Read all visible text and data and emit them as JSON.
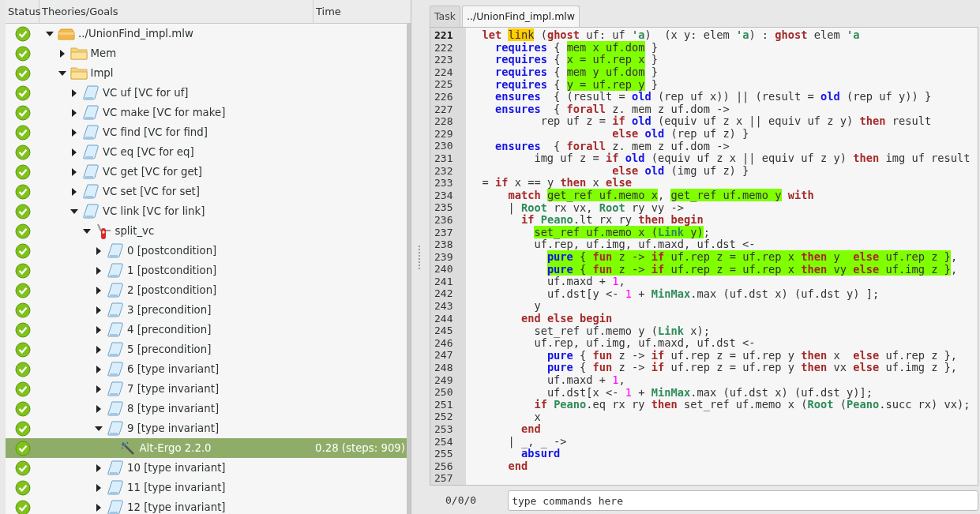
{
  "tree": {
    "columns": [
      "Status",
      "Theories/Goals",
      "Time"
    ],
    "nodes": [
      {
        "label": "../UnionFind_impl.mlw",
        "kind": "file",
        "proved": true,
        "expanded": true,
        "selected": false,
        "children": [
          {
            "label": "Mem",
            "kind": "theory",
            "proved": true,
            "expanded": false,
            "selected": false
          },
          {
            "label": "Impl",
            "kind": "theory",
            "proved": true,
            "expanded": true,
            "selected": false,
            "children": [
              {
                "label": "VC uf [VC for uf]",
                "kind": "goal",
                "proved": true,
                "expanded": false,
                "selected": false
              },
              {
                "label": "VC make [VC for make]",
                "kind": "goal",
                "proved": true,
                "expanded": false,
                "selected": false
              },
              {
                "label": "VC find [VC for find]",
                "kind": "goal",
                "proved": true,
                "expanded": false,
                "selected": false
              },
              {
                "label": "VC eq [VC for eq]",
                "kind": "goal",
                "proved": true,
                "expanded": false,
                "selected": false
              },
              {
                "label": "VC get [VC for get]",
                "kind": "goal",
                "proved": true,
                "expanded": false,
                "selected": false
              },
              {
                "label": "VC set [VC for set]",
                "kind": "goal",
                "proved": true,
                "expanded": false,
                "selected": false
              },
              {
                "label": "VC link [VC for link]",
                "kind": "goal",
                "proved": true,
                "expanded": true,
                "selected": false,
                "children": [
                  {
                    "label": "split_vc",
                    "kind": "transformation",
                    "proved": true,
                    "expanded": true,
                    "selected": false,
                    "children": [
                      {
                        "label": "0 [postcondition]",
                        "kind": "goal",
                        "proved": true,
                        "expanded": false,
                        "selected": false
                      },
                      {
                        "label": "1 [postcondition]",
                        "kind": "goal",
                        "proved": true,
                        "expanded": false,
                        "selected": false
                      },
                      {
                        "label": "2 [postcondition]",
                        "kind": "goal",
                        "proved": true,
                        "expanded": false,
                        "selected": false
                      },
                      {
                        "label": "3 [precondition]",
                        "kind": "goal",
                        "proved": true,
                        "expanded": false,
                        "selected": false
                      },
                      {
                        "label": "4 [precondition]",
                        "kind": "goal",
                        "proved": true,
                        "expanded": false,
                        "selected": false
                      },
                      {
                        "label": "5 [precondition]",
                        "kind": "goal",
                        "proved": true,
                        "expanded": false,
                        "selected": false
                      },
                      {
                        "label": "6 [type invariant]",
                        "kind": "goal",
                        "proved": true,
                        "expanded": false,
                        "selected": false
                      },
                      {
                        "label": "7 [type invariant]",
                        "kind": "goal",
                        "proved": true,
                        "expanded": false,
                        "selected": false
                      },
                      {
                        "label": "8 [type invariant]",
                        "kind": "goal",
                        "proved": true,
                        "expanded": false,
                        "selected": false
                      },
                      {
                        "label": "9 [type invariant]",
                        "kind": "goal",
                        "proved": true,
                        "expanded": true,
                        "selected": false,
                        "children": [
                          {
                            "label": "Alt-Ergo 2.2.0",
                            "kind": "prover",
                            "proved": true,
                            "selected": true,
                            "time": "0.28 (steps: 909)"
                          }
                        ]
                      },
                      {
                        "label": "10 [type invariant]",
                        "kind": "goal",
                        "proved": true,
                        "expanded": false,
                        "selected": false
                      },
                      {
                        "label": "11 [type invariant]",
                        "kind": "goal",
                        "proved": true,
                        "expanded": false,
                        "selected": false
                      },
                      {
                        "label": "12 [type invariant]",
                        "kind": "goal",
                        "proved": true,
                        "expanded": false,
                        "selected": false
                      }
                    ]
                  }
                ]
              }
            ]
          }
        ]
      }
    ]
  },
  "tabs": [
    {
      "label": "Task",
      "selected": false
    },
    {
      "label": "../UnionFind_impl.mlw",
      "selected": true
    }
  ],
  "editor": {
    "lines": [
      {
        "number": "221",
        "current": true,
        "segments": [
          {
            "text": "  let ",
            "kind": "keyword"
          },
          {
            "text": "link",
            "kind": "plain",
            "color": "#ffcc00"
          },
          {
            "text": " (",
            "kind": "plain"
          },
          {
            "text": "ghost",
            "kind": "keyword"
          },
          {
            "text": " uf: uf ",
            "kind": "plain"
          },
          {
            "text": "'a",
            "kind": "module"
          },
          {
            "text": ")  (x y: elem ",
            "kind": "plain"
          },
          {
            "text": "'a",
            "kind": "module"
          },
          {
            "text": ") : ",
            "kind": "plain"
          },
          {
            "text": "ghost",
            "kind": "keyword"
          },
          {
            "text": " elem ",
            "kind": "plain"
          },
          {
            "text": "'a",
            "kind": "module"
          }
        ]
      },
      {
        "number": "222",
        "current": false,
        "segments": [
          {
            "text": "    requires",
            "kind": "spec"
          },
          {
            "text": " { ",
            "kind": "plain"
          },
          {
            "text": "mem x uf.dom",
            "kind": "plain",
            "color": "#80ff00"
          },
          {
            "text": " }",
            "kind": "plain"
          }
        ]
      },
      {
        "number": "223",
        "current": false,
        "segments": [
          {
            "text": "    requires",
            "kind": "spec"
          },
          {
            "text": " { ",
            "kind": "plain"
          },
          {
            "text": "x = uf.rep x",
            "kind": "plain",
            "color": "#80ff00"
          },
          {
            "text": " }",
            "kind": "plain"
          }
        ]
      },
      {
        "number": "224",
        "current": false,
        "segments": [
          {
            "text": "    requires",
            "kind": "spec"
          },
          {
            "text": " { ",
            "kind": "plain"
          },
          {
            "text": "mem y uf.dom",
            "kind": "plain",
            "color": "#80ff00"
          },
          {
            "text": " }",
            "kind": "plain"
          }
        ]
      },
      {
        "number": "225",
        "current": false,
        "segments": [
          {
            "text": "    requires",
            "kind": "spec"
          },
          {
            "text": " { ",
            "kind": "plain"
          },
          {
            "text": "y = uf.rep y",
            "kind": "plain",
            "color": "#80ff00"
          },
          {
            "text": " }",
            "kind": "plain"
          }
        ]
      },
      {
        "number": "226",
        "current": false,
        "segments": [
          {
            "text": "    ensures",
            "kind": "spec"
          },
          {
            "text": "  { (result = ",
            "kind": "plain"
          },
          {
            "text": "old",
            "kind": "spec"
          },
          {
            "text": " (rep uf x)) || (result = ",
            "kind": "plain"
          },
          {
            "text": "old",
            "kind": "spec"
          },
          {
            "text": " (rep uf y)) }",
            "kind": "plain"
          }
        ]
      },
      {
        "number": "227",
        "current": false,
        "segments": [
          {
            "text": "    ensures",
            "kind": "spec"
          },
          {
            "text": "  { ",
            "kind": "plain"
          },
          {
            "text": "forall",
            "kind": "keyword"
          },
          {
            "text": " z. mem z uf.dom ->",
            "kind": "plain"
          }
        ]
      },
      {
        "number": "228",
        "current": false,
        "segments": [
          {
            "text": "           rep uf z = ",
            "kind": "plain"
          },
          {
            "text": "if ",
            "kind": "keyword"
          },
          {
            "text": "old",
            "kind": "spec"
          },
          {
            "text": " (equiv uf z x || equiv uf z y) ",
            "kind": "plain"
          },
          {
            "text": "then",
            "kind": "keyword"
          },
          {
            "text": " result",
            "kind": "plain"
          }
        ]
      },
      {
        "number": "229",
        "current": false,
        "segments": [
          {
            "text": "                      else ",
            "kind": "keyword"
          },
          {
            "text": "old",
            "kind": "spec"
          },
          {
            "text": " (rep uf z) }",
            "kind": "plain"
          }
        ]
      },
      {
        "number": "230",
        "current": false,
        "segments": [
          {
            "text": "    ensures",
            "kind": "spec"
          },
          {
            "text": "  { ",
            "kind": "plain"
          },
          {
            "text": "forall",
            "kind": "keyword"
          },
          {
            "text": " z. mem z uf.dom ->",
            "kind": "plain"
          }
        ]
      },
      {
        "number": "231",
        "current": false,
        "segments": [
          {
            "text": "          img uf z = ",
            "kind": "plain"
          },
          {
            "text": "if ",
            "kind": "keyword"
          },
          {
            "text": "old",
            "kind": "spec"
          },
          {
            "text": " (equiv uf z x || equiv uf z y) ",
            "kind": "plain"
          },
          {
            "text": "then",
            "kind": "keyword"
          },
          {
            "text": " img uf result",
            "kind": "plain"
          }
        ]
      },
      {
        "number": "232",
        "current": false,
        "segments": [
          {
            "text": "                      else ",
            "kind": "keyword"
          },
          {
            "text": "old",
            "kind": "spec"
          },
          {
            "text": " (img uf z) }",
            "kind": "plain"
          }
        ]
      },
      {
        "number": "233",
        "current": false,
        "segments": [
          {
            "text": "  = ",
            "kind": "plain"
          },
          {
            "text": "if",
            "kind": "keyword"
          },
          {
            "text": " x == y ",
            "kind": "plain"
          },
          {
            "text": "then",
            "kind": "keyword"
          },
          {
            "text": " x ",
            "kind": "plain"
          },
          {
            "text": "else",
            "kind": "keyword"
          }
        ]
      },
      {
        "number": "234",
        "current": false,
        "segments": [
          {
            "text": "      match ",
            "kind": "keyword"
          },
          {
            "text": "get_ref uf.memo x",
            "kind": "plain",
            "color": "#80ff00"
          },
          {
            "text": ", ",
            "kind": "plain"
          },
          {
            "text": "get_ref uf.memo y",
            "kind": "plain",
            "color": "#80ff00"
          },
          {
            "text": " with",
            "kind": "keyword"
          }
        ]
      },
      {
        "number": "235",
        "current": false,
        "segments": [
          {
            "text": "      | ",
            "kind": "plain"
          },
          {
            "text": "Root",
            "kind": "module"
          },
          {
            "text": " rx vx, ",
            "kind": "plain"
          },
          {
            "text": "Root",
            "kind": "module"
          },
          {
            "text": " ry vy ->",
            "kind": "plain"
          }
        ]
      },
      {
        "number": "236",
        "current": false,
        "segments": [
          {
            "text": "        if ",
            "kind": "keyword"
          },
          {
            "text": "Peano",
            "kind": "module"
          },
          {
            "text": ".lt rx ry ",
            "kind": "plain"
          },
          {
            "text": "then begin",
            "kind": "keyword"
          }
        ]
      },
      {
        "number": "237",
        "current": false,
        "segments": [
          {
            "text": "          set_ref uf.memo x (",
            "kind": "plain",
            "color": "#80ff00"
          },
          {
            "text": "Link",
            "kind": "module",
            "color": "#80ff00"
          },
          {
            "text": " y)",
            "kind": "plain",
            "color": "#80ff00"
          },
          {
            "text": ";",
            "kind": "plain"
          }
        ]
      },
      {
        "number": "238",
        "current": false,
        "segments": [
          {
            "text": "          uf.rep, uf.img, uf.maxd, uf.dst <-",
            "kind": "plain"
          }
        ]
      },
      {
        "number": "239",
        "current": false,
        "segments": [
          {
            "text": "            pure",
            "kind": "spec",
            "color": "#80ff00"
          },
          {
            "text": " { ",
            "kind": "plain",
            "color": "#80ff00"
          },
          {
            "text": "fun",
            "kind": "keyword",
            "color": "#80ff00"
          },
          {
            "text": " z -> ",
            "kind": "plain",
            "color": "#80ff00"
          },
          {
            "text": "if",
            "kind": "keyword",
            "color": "#80ff00"
          },
          {
            "text": " uf.rep z = uf.rep x ",
            "kind": "plain",
            "color": "#80ff00"
          },
          {
            "text": "then",
            "kind": "keyword",
            "color": "#80ff00"
          },
          {
            "text": " y  ",
            "kind": "plain",
            "color": "#80ff00"
          },
          {
            "text": "else",
            "kind": "keyword",
            "color": "#80ff00"
          },
          {
            "text": " uf.rep z }",
            "kind": "plain",
            "color": "#80ff00"
          },
          {
            "text": ",",
            "kind": "plain"
          }
        ]
      },
      {
        "number": "240",
        "current": false,
        "segments": [
          {
            "text": "            pure",
            "kind": "spec",
            "color": "#80ff00"
          },
          {
            "text": " { ",
            "kind": "plain",
            "color": "#80ff00"
          },
          {
            "text": "fun",
            "kind": "keyword",
            "color": "#80ff00"
          },
          {
            "text": " z -> ",
            "kind": "plain",
            "color": "#80ff00"
          },
          {
            "text": "if",
            "kind": "keyword",
            "color": "#80ff00"
          },
          {
            "text": " uf.rep z = uf.rep x ",
            "kind": "plain",
            "color": "#80ff00"
          },
          {
            "text": "then",
            "kind": "keyword",
            "color": "#80ff00"
          },
          {
            "text": " vy ",
            "kind": "plain",
            "color": "#80ff00"
          },
          {
            "text": "else",
            "kind": "keyword",
            "color": "#80ff00"
          },
          {
            "text": " uf.img z }",
            "kind": "plain",
            "color": "#80ff00"
          },
          {
            "text": ",",
            "kind": "plain"
          }
        ]
      },
      {
        "number": "241",
        "current": false,
        "segments": [
          {
            "text": "            uf.maxd + ",
            "kind": "plain"
          },
          {
            "text": "1",
            "kind": "number"
          },
          {
            "text": ",",
            "kind": "plain"
          }
        ]
      },
      {
        "number": "242",
        "current": false,
        "segments": [
          {
            "text": "            uf.dst[y <- ",
            "kind": "plain"
          },
          {
            "text": "1",
            "kind": "number"
          },
          {
            "text": " + ",
            "kind": "plain"
          },
          {
            "text": "MinMax",
            "kind": "module"
          },
          {
            "text": ".max (uf.dst x) (uf.dst y) ];",
            "kind": "plain"
          }
        ]
      },
      {
        "number": "243",
        "current": false,
        "segments": [
          {
            "text": "          y",
            "kind": "plain"
          }
        ]
      },
      {
        "number": "244",
        "current": false,
        "segments": [
          {
            "text": "        end else begin",
            "kind": "keyword"
          }
        ]
      },
      {
        "number": "245",
        "current": false,
        "segments": [
          {
            "text": "          set_ref uf.memo y (",
            "kind": "plain"
          },
          {
            "text": "Link",
            "kind": "module"
          },
          {
            "text": " x);",
            "kind": "plain"
          }
        ]
      },
      {
        "number": "246",
        "current": false,
        "segments": [
          {
            "text": "          uf.rep, uf.img, uf.maxd, uf.dst <-",
            "kind": "plain"
          }
        ]
      },
      {
        "number": "247",
        "current": false,
        "segments": [
          {
            "text": "            pure",
            "kind": "spec"
          },
          {
            "text": " { ",
            "kind": "plain"
          },
          {
            "text": "fun",
            "kind": "keyword"
          },
          {
            "text": " z -> ",
            "kind": "plain"
          },
          {
            "text": "if",
            "kind": "keyword"
          },
          {
            "text": " uf.rep z = uf.rep y ",
            "kind": "plain"
          },
          {
            "text": "then",
            "kind": "keyword"
          },
          {
            "text": " x  ",
            "kind": "plain"
          },
          {
            "text": "else",
            "kind": "keyword"
          },
          {
            "text": " uf.rep z },",
            "kind": "plain"
          }
        ]
      },
      {
        "number": "248",
        "current": false,
        "segments": [
          {
            "text": "            pure",
            "kind": "spec"
          },
          {
            "text": " { ",
            "kind": "plain"
          },
          {
            "text": "fun",
            "kind": "keyword"
          },
          {
            "text": " z -> ",
            "kind": "plain"
          },
          {
            "text": "if",
            "kind": "keyword"
          },
          {
            "text": " uf.rep z = uf.rep y ",
            "kind": "plain"
          },
          {
            "text": "then",
            "kind": "keyword"
          },
          {
            "text": " vx ",
            "kind": "plain"
          },
          {
            "text": "else",
            "kind": "keyword"
          },
          {
            "text": " uf.img z },",
            "kind": "plain"
          }
        ]
      },
      {
        "number": "249",
        "current": false,
        "segments": [
          {
            "text": "            uf.maxd + ",
            "kind": "plain"
          },
          {
            "text": "1",
            "kind": "number"
          },
          {
            "text": ",",
            "kind": "plain"
          }
        ]
      },
      {
        "number": "250",
        "current": false,
        "segments": [
          {
            "text": "            uf.dst[x <- ",
            "kind": "plain"
          },
          {
            "text": "1",
            "kind": "number"
          },
          {
            "text": " + ",
            "kind": "plain"
          },
          {
            "text": "MinMax",
            "kind": "module"
          },
          {
            "text": ".max (uf.dst x) (uf.dst y)];",
            "kind": "plain"
          }
        ]
      },
      {
        "number": "251",
        "current": false,
        "segments": [
          {
            "text": "          if ",
            "kind": "keyword"
          },
          {
            "text": "Peano",
            "kind": "module"
          },
          {
            "text": ".eq rx ry ",
            "kind": "plain"
          },
          {
            "text": "then",
            "kind": "keyword"
          },
          {
            "text": " set_ref uf.memo x (",
            "kind": "plain"
          },
          {
            "text": "Root",
            "kind": "module"
          },
          {
            "text": " (",
            "kind": "plain"
          },
          {
            "text": "Peano",
            "kind": "module"
          },
          {
            "text": ".succ rx) vx);",
            "kind": "plain"
          }
        ]
      },
      {
        "number": "252",
        "current": false,
        "segments": [
          {
            "text": "          x",
            "kind": "plain"
          }
        ]
      },
      {
        "number": "253",
        "current": false,
        "segments": [
          {
            "text": "        end",
            "kind": "keyword"
          }
        ]
      },
      {
        "number": "254",
        "current": false,
        "segments": [
          {
            "text": "      | _, _ ->",
            "kind": "plain"
          }
        ]
      },
      {
        "number": "255",
        "current": false,
        "segments": [
          {
            "text": "        absurd",
            "kind": "spec"
          }
        ]
      },
      {
        "number": "256",
        "current": false,
        "segments": [
          {
            "text": "      end",
            "kind": "keyword"
          }
        ]
      },
      {
        "number": "257",
        "current": false
      }
    ]
  },
  "status_bar": {
    "counter": "0/0/0",
    "command": {
      "placeholder": "type commands here"
    }
  }
}
